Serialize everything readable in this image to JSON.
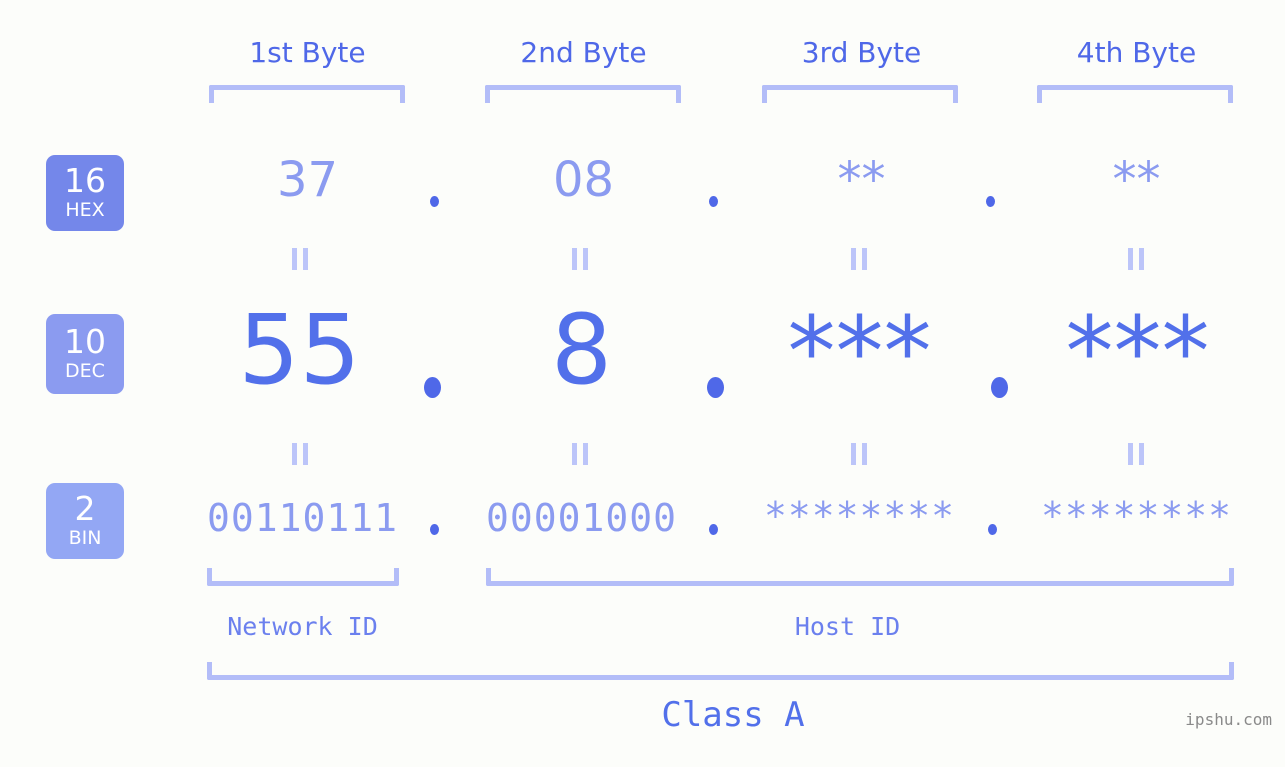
{
  "meta": {
    "background_color": "#fcfdfa",
    "accent_color": "#5270ea",
    "accent_light_color": "#8b9bf0",
    "bracket_color": "#b3bdf8",
    "watermark": "ipshu.com"
  },
  "byte_headers": [
    {
      "label": "1st Byte"
    },
    {
      "label": "2nd Byte"
    },
    {
      "label": "3rd Byte"
    },
    {
      "label": "4th Byte"
    }
  ],
  "rows": [
    {
      "badge_number": "16",
      "badge_name": "HEX",
      "badge_color": "#7487ea",
      "values": [
        "37",
        "08",
        "**",
        "**"
      ]
    },
    {
      "badge_number": "10",
      "badge_name": "DEC",
      "badge_color": "#8b9bf0",
      "values": [
        "55",
        "8",
        "***",
        "***"
      ]
    },
    {
      "badge_number": "2",
      "badge_name": "BIN",
      "badge_color": "#93a7f4",
      "values": [
        "00110111",
        "00001000",
        "********",
        "********"
      ]
    }
  ],
  "separators": {
    "symbol": "."
  },
  "equals": {
    "symbol": "="
  },
  "id_sections": [
    {
      "label": "Network ID"
    },
    {
      "label": "Host ID"
    }
  ],
  "class_section": {
    "label": "Class A"
  },
  "chart_data": {
    "type": "table",
    "title": "IP address byte breakdown",
    "columns": [
      "1st Byte",
      "2nd Byte",
      "3rd Byte",
      "4th Byte"
    ],
    "rows": [
      {
        "base": "16",
        "base_name": "HEX",
        "cells": [
          "37",
          "08",
          "**",
          "**"
        ]
      },
      {
        "base": "10",
        "base_name": "DEC",
        "cells": [
          "55",
          "8",
          "***",
          "***"
        ]
      },
      {
        "base": "2",
        "base_name": "BIN",
        "cells": [
          "00110111",
          "00001000",
          "********",
          "********"
        ]
      }
    ],
    "network_id_bytes": 1,
    "host_id_bytes": 3,
    "ip_class": "Class A"
  }
}
